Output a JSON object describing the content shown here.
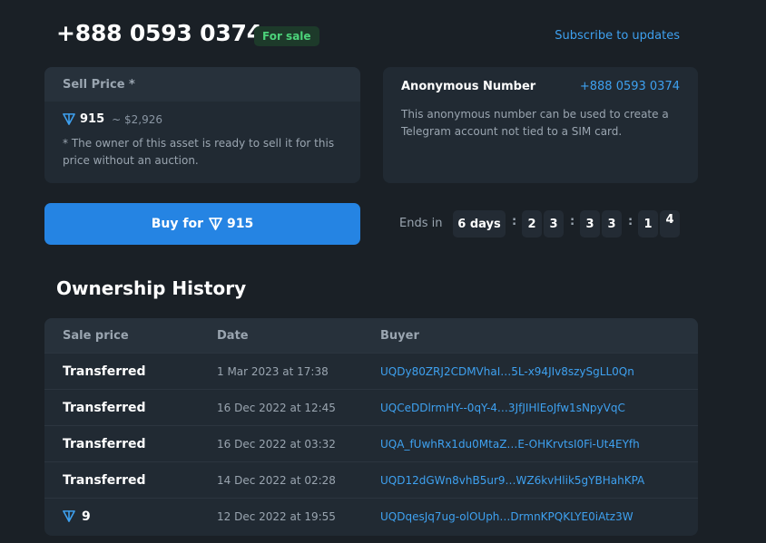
{
  "header": {
    "number": "+888 0593 0374",
    "status_badge": "For sale",
    "subscribe_label": "Subscribe to updates"
  },
  "sell_card": {
    "title": "Sell Price *",
    "price_ton": "915",
    "price_usd": "~ $2,926",
    "note": "* The owner of this asset is ready to sell it for this price without an auction."
  },
  "anon_card": {
    "title": "Anonymous Number",
    "number": "+888 0593 0374",
    "description": "This anonymous number can be used to create a Telegram account not tied to a SIM card."
  },
  "buy_button": {
    "label": "Buy for",
    "amount": "915"
  },
  "countdown": {
    "label": "Ends in",
    "days": "6 days",
    "separator": ":",
    "digits": [
      "2",
      "3",
      "3",
      "3",
      "1",
      "4"
    ]
  },
  "history": {
    "title": "Ownership History",
    "columns": [
      "Sale price",
      "Date",
      "Buyer"
    ],
    "rows": [
      {
        "price": "Transferred",
        "date": "1 Mar 2023 at 17:38",
        "buyer": "UQDy80ZRJ2CDMVhaI…5L-x94JIv8szySgLL0Qn"
      },
      {
        "price": "Transferred",
        "date": "16 Dec 2022 at 12:45",
        "buyer": "UQCeDDlrmHY--0qY-4…3JfJIHlEoJfw1sNpyVqC"
      },
      {
        "price": "Transferred",
        "date": "16 Dec 2022 at 03:32",
        "buyer": "UQA_fUwhRx1du0MtaZ…E-OHKrvtsI0Fi-Ut4EYfh"
      },
      {
        "price": "Transferred",
        "date": "14 Dec 2022 at 02:28",
        "buyer": "UQD12dGWn8vhB5ur9…WZ6kvHlik5gYBHahKPA"
      },
      {
        "price": "9",
        "date": "12 Dec 2022 at 19:55",
        "buyer": "UQDqesJq7ug-olOUph…DrmnKPQKLYE0iAtz3W"
      }
    ]
  },
  "icons": {
    "currency": "ton-icon"
  },
  "colors": {
    "background": "#1a2026",
    "card": "#212a33",
    "accent": "#2584e3",
    "link": "#3ea1f0",
    "badge_text": "#4cd37a"
  }
}
